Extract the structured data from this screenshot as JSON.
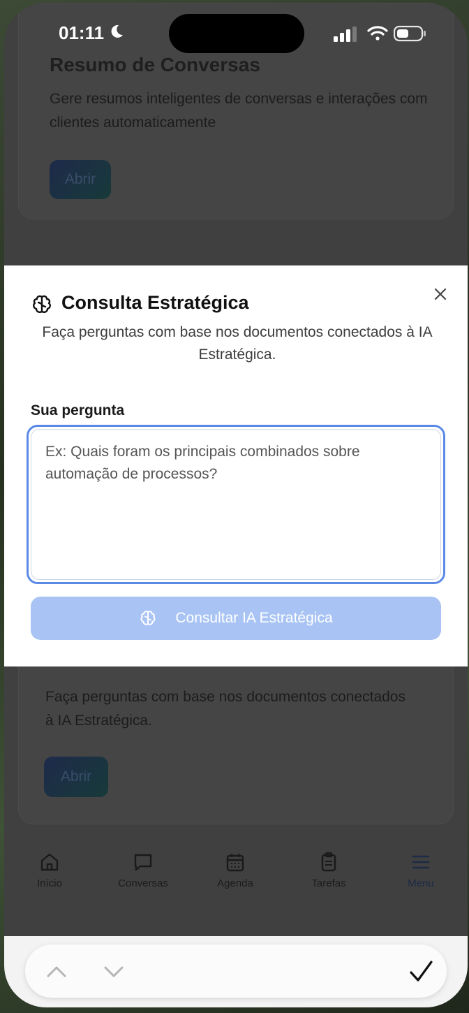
{
  "status_bar": {
    "time": "01:11"
  },
  "background": {
    "card_top": {
      "title": "Resumo de Conversas",
      "description": "Gere resumos inteligentes de conversas e interações com clientes automaticamente",
      "button": "Abrir"
    },
    "card_bottom": {
      "description": "Faça perguntas com base nos documentos conectados à IA Estratégica.",
      "button": "Abrir"
    }
  },
  "modal": {
    "title": "Consulta Estratégica",
    "subtitle": "Faça perguntas com base nos documentos conectados à IA Estratégica.",
    "field_label": "Sua pergunta",
    "textarea_placeholder": "Ex: Quais foram os principais combinados sobre automação de processos?",
    "textarea_value": "",
    "submit_label": "Consultar IA Estratégica",
    "icon": "brain-icon",
    "close_icon": "close-icon"
  },
  "tab_bar": {
    "items": [
      {
        "label": "Início",
        "icon": "home-icon"
      },
      {
        "label": "Conversas",
        "icon": "chat-icon"
      },
      {
        "label": "Agenda",
        "icon": "calendar-icon"
      },
      {
        "label": "Tarefas",
        "icon": "clipboard-icon"
      },
      {
        "label": "Menu",
        "icon": "menu-icon",
        "active": true
      }
    ]
  },
  "accessory_bar": {
    "prev_icon": "chevron-up-icon",
    "next_icon": "chevron-down-icon",
    "done_icon": "checkmark-icon"
  },
  "colors": {
    "accent": "#5b8ae6",
    "button_disabled": "#a9c4f4",
    "overlay": "#404040"
  }
}
